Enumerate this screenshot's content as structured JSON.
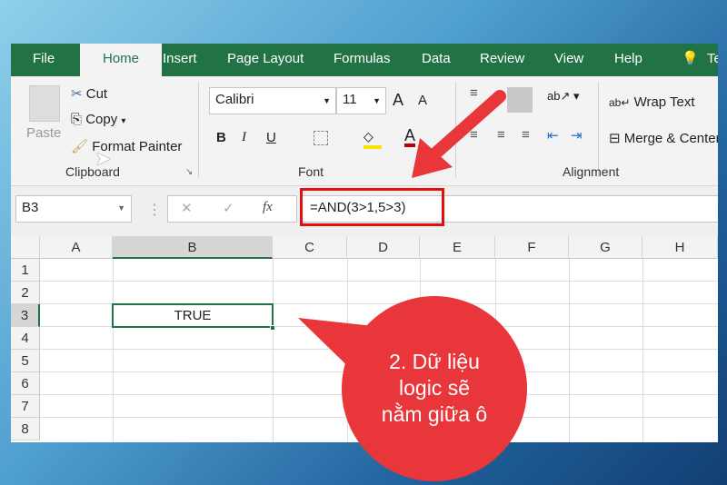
{
  "tabs": [
    "File",
    "Home",
    "Insert",
    "Page Layout",
    "Formulas",
    "Data",
    "Review",
    "View",
    "Help",
    "Te"
  ],
  "clipboard": {
    "paste": "Paste",
    "cut": "Cut",
    "copy": "Copy",
    "format_painter": "Format Painter",
    "group": "Clipboard"
  },
  "font": {
    "name": "Calibri",
    "size": "11",
    "bold": "B",
    "italic": "I",
    "underline": "U",
    "group": "Font",
    "grow": "A",
    "shrink": "A",
    "color": "A"
  },
  "alignment": {
    "wrap": "Wrap Text",
    "merge": "Merge & Center",
    "group": "Alignment"
  },
  "formula_bar": {
    "name_box": "B3",
    "fx": "fx",
    "formula": "=AND(3>1,5>3)"
  },
  "columns": [
    "A",
    "B",
    "C",
    "D",
    "E",
    "F",
    "G",
    "H"
  ],
  "rows": [
    "1",
    "2",
    "3",
    "4",
    "5",
    "6",
    "7",
    "8"
  ],
  "cells": {
    "B3": "TRUE"
  },
  "callout": {
    "text_lines": [
      "2. Dữ liệu",
      "logic sẽ",
      "nằm giữa ô"
    ]
  },
  "colors": {
    "excel_green": "#217346",
    "callout_red": "#e8363a",
    "highlight_red": "#e01010"
  }
}
